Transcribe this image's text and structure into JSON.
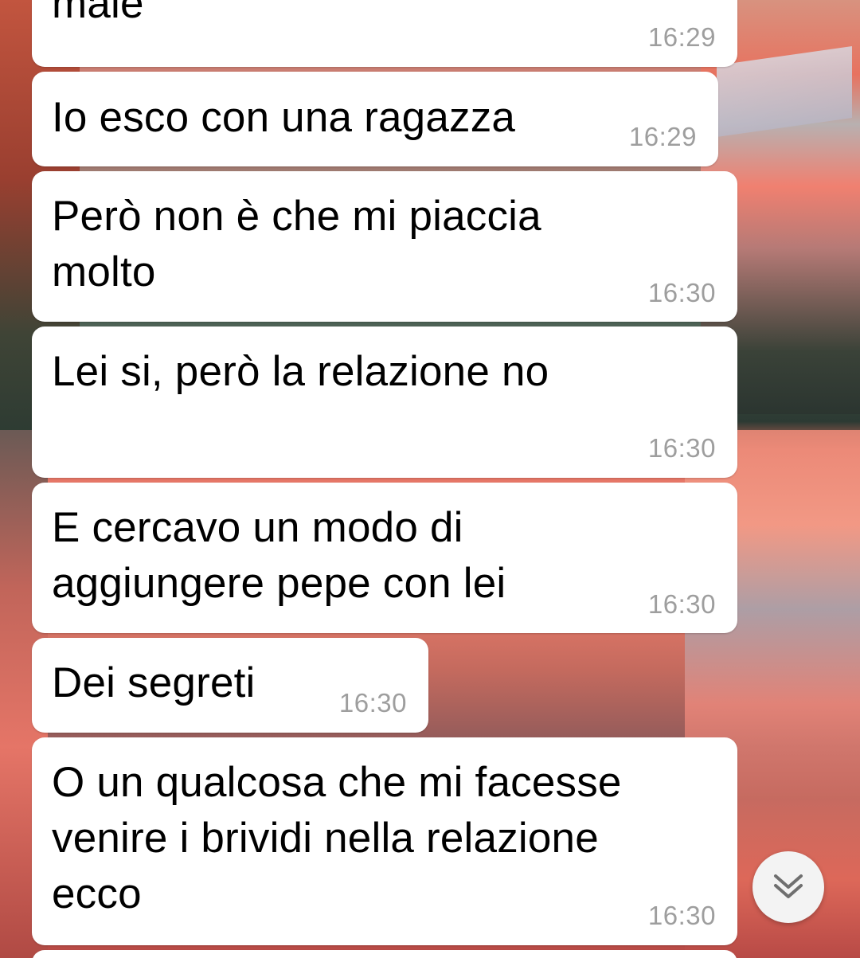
{
  "messages": [
    {
      "text": "male",
      "time": "16:29"
    },
    {
      "text": "Io esco con una ragazza",
      "time": "16:29"
    },
    {
      "text": "Però non è che mi piaccia\nmolto",
      "time": "16:30"
    },
    {
      "text": "Lei si, però la relazione no",
      "time": "16:30"
    },
    {
      "text": "E cercavo un modo di\naggiungere pepe con lei",
      "time": "16:30"
    },
    {
      "text": "Dei segreti",
      "time": "16:30"
    },
    {
      "text": "O un qualcosa che mi facesse\nvenire i brividi nella relazione\necco",
      "time": "16:30"
    }
  ],
  "scroll_button": {
    "icon": "double-chevron-down-icon"
  },
  "colors": {
    "bubble_bg": "#ffffff",
    "text": "#000000",
    "time": "#9e9e9e",
    "scroll_button_bg": "#f3f3f3",
    "scroll_button_icon": "#6f6f6f"
  }
}
